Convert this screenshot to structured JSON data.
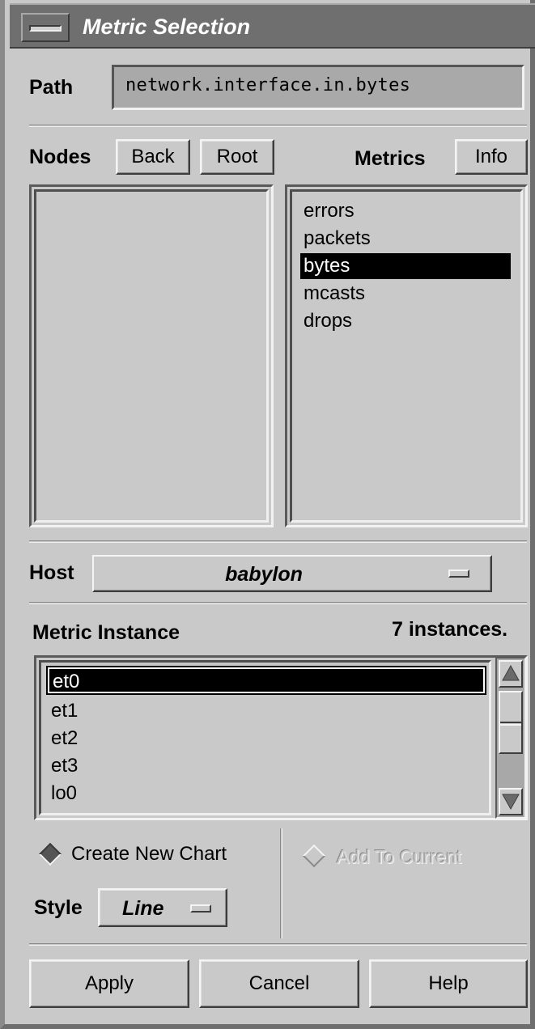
{
  "window": {
    "title": "Metric Selection"
  },
  "path": {
    "label": "Path",
    "value": "network.interface.in.bytes"
  },
  "nodes": {
    "label": "Nodes",
    "back_label": "Back",
    "root_label": "Root",
    "items": []
  },
  "metrics": {
    "label": "Metrics",
    "info_label": "Info",
    "items": [
      "errors",
      "packets",
      "bytes",
      "mcasts",
      "drops"
    ],
    "selected": "bytes"
  },
  "host": {
    "label": "Host",
    "value": "babylon"
  },
  "instances": {
    "label": "Metric Instance",
    "count_text": "7 instances.",
    "items": [
      "et0",
      "et1",
      "et2",
      "et3",
      "lo0"
    ],
    "selected": "et0"
  },
  "options": {
    "create_new_chart": "Create New Chart",
    "add_to_current": "Add To Current",
    "style_label": "Style",
    "style_value": "Line",
    "selected": "create_new_chart"
  },
  "actions": {
    "apply": "Apply",
    "cancel": "Cancel",
    "help": "Help"
  }
}
